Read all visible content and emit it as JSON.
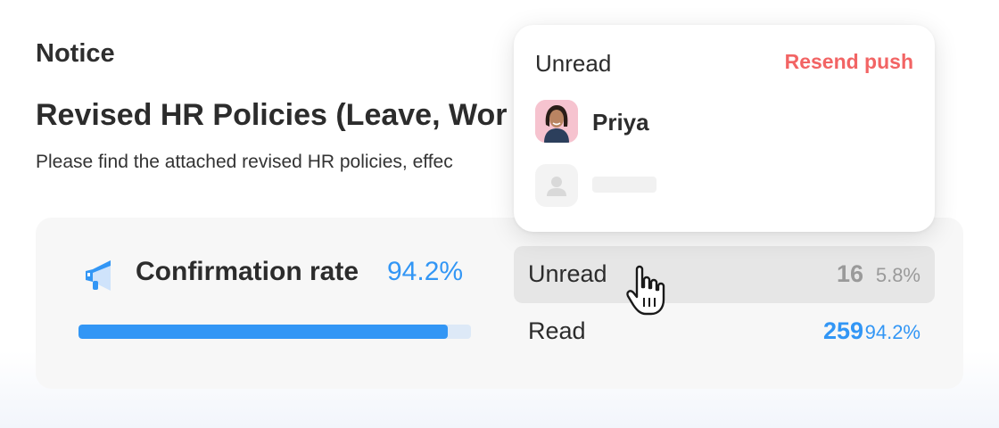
{
  "notice": {
    "label": "Notice",
    "title": "Revised HR Policies (Leave, Wor",
    "body": "Please find the attached revised HR policies, effec"
  },
  "stats": {
    "rate_label": "Confirmation rate",
    "rate_value": "94.2%",
    "progress_fraction": 0.942,
    "rows": [
      {
        "label": "Unread",
        "count": "16",
        "percent": "5.8%"
      },
      {
        "label": "Read",
        "count": "259",
        "percent": "94.2%"
      }
    ]
  },
  "popover": {
    "title": "Unread",
    "action": "Resend push",
    "users": [
      {
        "name": "Priya",
        "avatar": "photo"
      },
      {
        "name": "",
        "avatar": "placeholder-user-icon"
      }
    ]
  },
  "colors": {
    "accent": "#3296f5",
    "danger": "#f26464",
    "muted": "#9a9a9a"
  },
  "icons": {
    "megaphone": "megaphone-icon",
    "cursor": "hand-pointer-icon"
  }
}
